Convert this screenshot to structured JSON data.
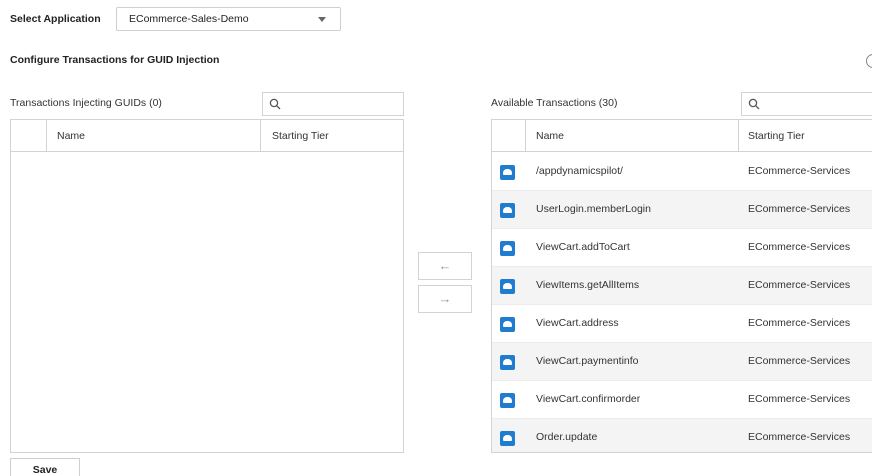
{
  "select_application": {
    "label": "Select Application",
    "value": "ECommerce-Sales-Demo"
  },
  "section_title": "Configure Transactions for GUID Injection",
  "left_panel": {
    "title": "Transactions Injecting GUIDs (0)",
    "search_placeholder": "",
    "columns": [
      "Name",
      "Starting Tier"
    ],
    "rows": []
  },
  "right_panel": {
    "title": "Available Transactions (30)",
    "search_placeholder": "",
    "columns": [
      "Name",
      "Starting Tier"
    ],
    "rows": [
      {
        "icon": "cloud-icon",
        "name": "/appdynamicspilot/",
        "tier": "ECommerce-Services"
      },
      {
        "icon": "business-transaction-icon",
        "name": "UserLogin.memberLogin",
        "tier": "ECommerce-Services"
      },
      {
        "icon": "business-transaction-icon",
        "name": "ViewCart.addToCart",
        "tier": "ECommerce-Services"
      },
      {
        "icon": "business-transaction-icon",
        "name": "ViewItems.getAllItems",
        "tier": "ECommerce-Services"
      },
      {
        "icon": "business-transaction-icon",
        "name": "ViewCart.address",
        "tier": "ECommerce-Services"
      },
      {
        "icon": "business-transaction-icon",
        "name": "ViewCart.paymentinfo",
        "tier": "ECommerce-Services"
      },
      {
        "icon": "business-transaction-icon",
        "name": "ViewCart.confirmorder",
        "tier": "ECommerce-Services"
      },
      {
        "icon": "business-transaction-icon",
        "name": "Order.update",
        "tier": "ECommerce-Services"
      }
    ]
  },
  "move_left_glyph": "←",
  "move_right_glyph": "→",
  "save_label": "Save",
  "colors": {
    "accent": "#1f7ccf",
    "border": "#d3d3d3",
    "alt_row": "#f4f4f4"
  }
}
